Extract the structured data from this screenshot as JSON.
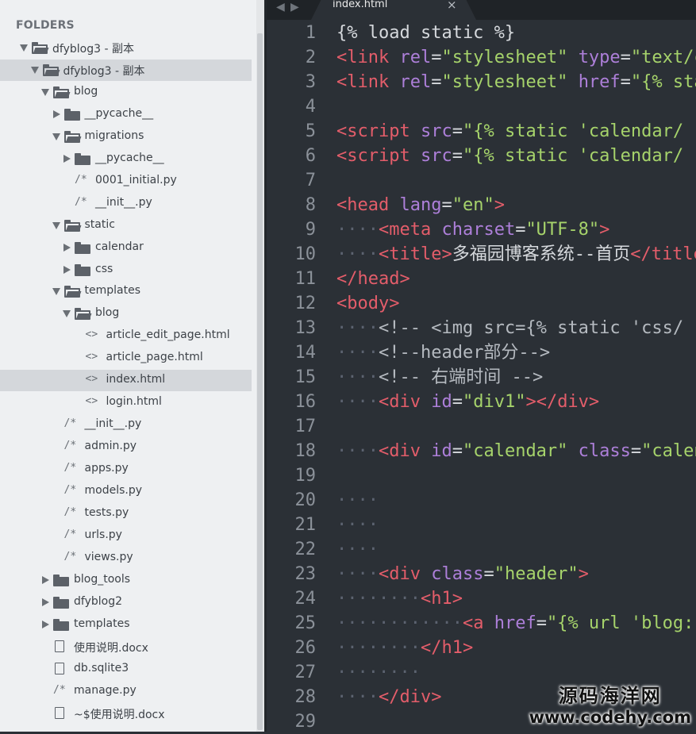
{
  "sidebar": {
    "title": "FOLDERS",
    "items": [
      {
        "label": "dfyblog3 - 副本",
        "type": "folder",
        "open": true,
        "depth": 0
      },
      {
        "label": "dfyblog3 - 副本",
        "type": "folder",
        "open": true,
        "depth": 1,
        "selected": true
      },
      {
        "label": "blog",
        "type": "folder",
        "open": true,
        "depth": 2
      },
      {
        "label": "__pycache__",
        "type": "folder",
        "open": false,
        "depth": 3
      },
      {
        "label": "migrations",
        "type": "folder",
        "open": true,
        "depth": 3
      },
      {
        "label": "__pycache__",
        "type": "folder",
        "open": false,
        "depth": 4
      },
      {
        "label": "0001_initial.py",
        "type": "py",
        "glyph": "/*",
        "depth": 4
      },
      {
        "label": "__init__.py",
        "type": "py",
        "glyph": "/*",
        "depth": 4
      },
      {
        "label": "static",
        "type": "folder",
        "open": true,
        "depth": 3
      },
      {
        "label": "calendar",
        "type": "folder",
        "open": false,
        "depth": 4
      },
      {
        "label": "css",
        "type": "folder",
        "open": false,
        "depth": 4
      },
      {
        "label": "templates",
        "type": "folder",
        "open": true,
        "depth": 3
      },
      {
        "label": "blog",
        "type": "folder",
        "open": true,
        "depth": 4
      },
      {
        "label": "article_edit_page.html",
        "type": "html",
        "glyph": "<>",
        "depth": 5
      },
      {
        "label": "article_page.html",
        "type": "html",
        "glyph": "<>",
        "depth": 5
      },
      {
        "label": "index.html",
        "type": "html",
        "glyph": "<>",
        "depth": 5,
        "selected": true
      },
      {
        "label": "login.html",
        "type": "html",
        "glyph": "<>",
        "depth": 5
      },
      {
        "label": "__init__.py",
        "type": "py",
        "glyph": "/*",
        "depth": 3
      },
      {
        "label": "admin.py",
        "type": "py",
        "glyph": "/*",
        "depth": 3
      },
      {
        "label": "apps.py",
        "type": "py",
        "glyph": "/*",
        "depth": 3
      },
      {
        "label": "models.py",
        "type": "py",
        "glyph": "/*",
        "depth": 3
      },
      {
        "label": "tests.py",
        "type": "py",
        "glyph": "/*",
        "depth": 3
      },
      {
        "label": "urls.py",
        "type": "py",
        "glyph": "/*",
        "depth": 3
      },
      {
        "label": "views.py",
        "type": "py",
        "glyph": "/*",
        "depth": 3
      },
      {
        "label": "blog_tools",
        "type": "folder",
        "open": false,
        "depth": 2
      },
      {
        "label": "dfyblog2",
        "type": "folder",
        "open": false,
        "depth": 2
      },
      {
        "label": "templates",
        "type": "folder",
        "open": false,
        "depth": 2
      },
      {
        "label": "使用说明.docx",
        "type": "file",
        "depth": 2
      },
      {
        "label": "db.sqlite3",
        "type": "file",
        "depth": 2
      },
      {
        "label": "manage.py",
        "type": "py",
        "glyph": "/*",
        "depth": 2
      },
      {
        "label": "~$使用说明.docx",
        "type": "file",
        "depth": 2
      }
    ]
  },
  "tabs": {
    "back": "◀",
    "forward": "▶",
    "active": "index.html",
    "close": "×"
  },
  "editor": {
    "lines": [
      {
        "n": "1",
        "tokens": [
          [
            "p",
            "{% load static %}"
          ]
        ]
      },
      {
        "n": "2",
        "tokens": [
          [
            "t",
            "<link"
          ],
          [
            "p",
            " "
          ],
          [
            "a",
            "rel"
          ],
          [
            "p",
            "="
          ],
          [
            "s",
            "\"stylesheet\""
          ],
          [
            "p",
            " "
          ],
          [
            "a",
            "type"
          ],
          [
            "p",
            "="
          ],
          [
            "s",
            "\"text/css\""
          ]
        ]
      },
      {
        "n": "3",
        "tokens": [
          [
            "t",
            "<link"
          ],
          [
            "p",
            " "
          ],
          [
            "a",
            "rel"
          ],
          [
            "p",
            "="
          ],
          [
            "s",
            "\"stylesheet\""
          ],
          [
            "p",
            " "
          ],
          [
            "a",
            "href"
          ],
          [
            "p",
            "="
          ],
          [
            "s",
            "\"{% static"
          ]
        ]
      },
      {
        "n": "4",
        "tokens": []
      },
      {
        "n": "5",
        "tokens": [
          [
            "t",
            "<script"
          ],
          [
            "p",
            " "
          ],
          [
            "a",
            "src"
          ],
          [
            "p",
            "="
          ],
          [
            "s",
            "\"{% static 'calendar/"
          ]
        ]
      },
      {
        "n": "6",
        "tokens": [
          [
            "t",
            "<script"
          ],
          [
            "p",
            " "
          ],
          [
            "a",
            "src"
          ],
          [
            "p",
            "="
          ],
          [
            "s",
            "\"{% static 'calendar/"
          ]
        ]
      },
      {
        "n": "7",
        "tokens": []
      },
      {
        "n": "8",
        "tokens": [
          [
            "t",
            "<head"
          ],
          [
            "p",
            " "
          ],
          [
            "a",
            "lang"
          ],
          [
            "p",
            "="
          ],
          [
            "s",
            "\"en\""
          ],
          [
            "t",
            ">"
          ]
        ]
      },
      {
        "n": "9",
        "tokens": [
          [
            "d",
            "····"
          ],
          [
            "t",
            "<meta"
          ],
          [
            "p",
            " "
          ],
          [
            "a",
            "charset"
          ],
          [
            "p",
            "="
          ],
          [
            "s",
            "\"UTF-8\""
          ],
          [
            "t",
            ">"
          ]
        ]
      },
      {
        "n": "10",
        "tokens": [
          [
            "d",
            "····"
          ],
          [
            "t",
            "<title>"
          ],
          [
            "p",
            "多福园博客系统--首页"
          ],
          [
            "t",
            "</title>"
          ]
        ]
      },
      {
        "n": "11",
        "tokens": [
          [
            "t",
            "</head>"
          ]
        ]
      },
      {
        "n": "12",
        "tokens": [
          [
            "t",
            "<body>"
          ]
        ]
      },
      {
        "n": "13",
        "tokens": [
          [
            "d",
            "····"
          ],
          [
            "c",
            "<!-- <img src={% static 'css/"
          ]
        ]
      },
      {
        "n": "14",
        "tokens": [
          [
            "d",
            "····"
          ],
          [
            "c",
            "<!--header部分-->"
          ]
        ]
      },
      {
        "n": "15",
        "tokens": [
          [
            "d",
            "····"
          ],
          [
            "c",
            "<!-- 右端时间 -->"
          ]
        ]
      },
      {
        "n": "16",
        "tokens": [
          [
            "d",
            "····"
          ],
          [
            "t",
            "<div"
          ],
          [
            "p",
            " "
          ],
          [
            "a",
            "id"
          ],
          [
            "p",
            "="
          ],
          [
            "s",
            "\"div1\""
          ],
          [
            "t",
            "></div>"
          ]
        ]
      },
      {
        "n": "17",
        "tokens": []
      },
      {
        "n": "18",
        "tokens": [
          [
            "d",
            "····"
          ],
          [
            "t",
            "<div"
          ],
          [
            "p",
            " "
          ],
          [
            "a",
            "id"
          ],
          [
            "p",
            "="
          ],
          [
            "s",
            "\"calendar\""
          ],
          [
            "p",
            " "
          ],
          [
            "a",
            "class"
          ],
          [
            "p",
            "="
          ],
          [
            "s",
            "\"calendar\""
          ]
        ]
      },
      {
        "n": "19",
        "tokens": []
      },
      {
        "n": "20",
        "tokens": [
          [
            "d",
            "····"
          ]
        ]
      },
      {
        "n": "21",
        "tokens": [
          [
            "d",
            "····"
          ]
        ]
      },
      {
        "n": "22",
        "tokens": [
          [
            "d",
            "····"
          ]
        ]
      },
      {
        "n": "23",
        "tokens": [
          [
            "d",
            "····"
          ],
          [
            "t",
            "<div"
          ],
          [
            "p",
            " "
          ],
          [
            "a",
            "class"
          ],
          [
            "p",
            "="
          ],
          [
            "s",
            "\"header\""
          ],
          [
            "t",
            ">"
          ]
        ]
      },
      {
        "n": "24",
        "tokens": [
          [
            "d",
            "········"
          ],
          [
            "t",
            "<h1>"
          ]
        ]
      },
      {
        "n": "25",
        "tokens": [
          [
            "d",
            "············"
          ],
          [
            "t",
            "<a"
          ],
          [
            "p",
            " "
          ],
          [
            "a",
            "href"
          ],
          [
            "p",
            "="
          ],
          [
            "s",
            "\"{% url 'blog:"
          ]
        ]
      },
      {
        "n": "26",
        "tokens": [
          [
            "d",
            "········"
          ],
          [
            "t",
            "</h1>"
          ]
        ]
      },
      {
        "n": "27",
        "tokens": [
          [
            "d",
            "········"
          ]
        ]
      },
      {
        "n": "28",
        "tokens": [
          [
            "d",
            "····"
          ],
          [
            "t",
            "</div>"
          ]
        ]
      },
      {
        "n": "29",
        "tokens": []
      }
    ]
  },
  "watermark": {
    "line1": "源码海洋网",
    "line2": "www.codehy.com"
  }
}
